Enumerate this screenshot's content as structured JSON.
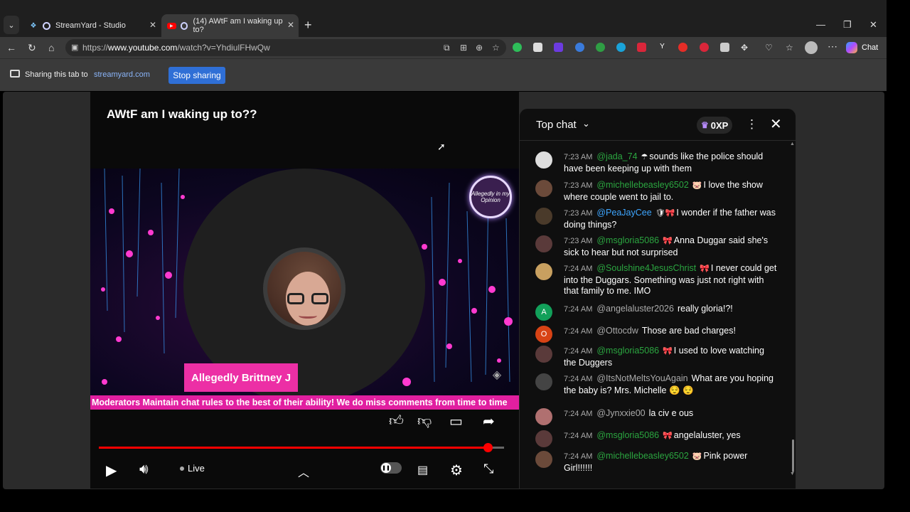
{
  "browser": {
    "tabs": [
      {
        "title": "StreamYard - Studio",
        "active": false
      },
      {
        "title": "(14) AWtF am I waking up to?",
        "active": true
      }
    ],
    "url_prefix": "https://",
    "url_host": "www.youtube.com",
    "url_path": "/watch?v=YhdiulFHwQw",
    "copilot_label": "Chat"
  },
  "sharebar": {
    "text": "Sharing this tab to",
    "link": "streamyard.com",
    "stop_label": "Stop sharing"
  },
  "video": {
    "title": "AWtF am I waking up to??",
    "logo_text": "Allegedly in my Opinion",
    "name_tag": "Allegedly Brittney J",
    "ticker": "Moderators Maintain chat rules to the best of their ability! We do miss comments from time to time",
    "live_label": "Live",
    "progress": 0.96
  },
  "chat": {
    "title": "Top chat",
    "xp": "0XP",
    "messages": [
      {
        "time": "7:23 AM",
        "user": "@jada_74",
        "user_color": "green",
        "badge": "☂",
        "text": "sounds like the police should have been keeping up with them",
        "avatar_color": "#dedede",
        "avatar_letter": ""
      },
      {
        "time": "7:23 AM",
        "user": "@michellebeasley6502",
        "user_color": "green",
        "badge": "🐷",
        "text": "I love the show where couple went to jail to.",
        "avatar_color": "#6b4a3a",
        "avatar_letter": ""
      },
      {
        "time": "7:23 AM",
        "user": "@PeaJayCee",
        "user_color": "blue",
        "badge": "🛡🎀",
        "text": "I wonder if the father was doing things?",
        "avatar_color": "#4a3a2a",
        "avatar_letter": ""
      },
      {
        "time": "7:23 AM",
        "user": "@msgloria5086",
        "user_color": "green",
        "badge": "🎀",
        "text": "Anna Duggar said she's sick to hear but not surprised",
        "avatar_color": "#5a3a3a",
        "avatar_letter": ""
      },
      {
        "time": "7:24 AM",
        "user": "@Soulshine4JesusChrist",
        "user_color": "green",
        "badge": "🎀",
        "text": "I never could get into the Duggars. Something was just not right with that family to me. IMO",
        "avatar_color": "#c8a060",
        "avatar_letter": ""
      },
      {
        "time": "7:24 AM",
        "user": "@angelaluster2026",
        "user_color": "gray",
        "badge": "",
        "text": "really gloria!?!",
        "avatar_color": "#12a05a",
        "avatar_letter": "A"
      },
      {
        "time": "7:24 AM",
        "user": "@Ottocdw",
        "user_color": "gray",
        "badge": "",
        "text": "Those are bad charges!",
        "avatar_color": "#d84315",
        "avatar_letter": "O"
      },
      {
        "time": "7:24 AM",
        "user": "@msgloria5086",
        "user_color": "green",
        "badge": "🎀",
        "text": "I used to love watching the Duggers",
        "avatar_color": "#5a3a3a",
        "avatar_letter": ""
      },
      {
        "time": "7:24 AM",
        "user": "@ItsNotMeltsYouAgain",
        "user_color": "gray",
        "badge": "",
        "text": "What are you hoping the baby is? Mrs. Michelle 😌 😌",
        "avatar_color": "#444",
        "avatar_letter": ""
      },
      {
        "time": "7:24 AM",
        "user": "@Jynxxie00",
        "user_color": "gray",
        "badge": "",
        "text": "la civ e ous",
        "avatar_color": "#b07070",
        "avatar_letter": ""
      },
      {
        "time": "7:24 AM",
        "user": "@msgloria5086",
        "user_color": "green",
        "badge": "🎀",
        "text": "angelaluster, yes",
        "avatar_color": "#5a3a3a",
        "avatar_letter": ""
      },
      {
        "time": "7:24 AM",
        "user": "@michellebeasley6502",
        "user_color": "green",
        "badge": "🐷",
        "text": "Pink power Girl!!!!!!",
        "avatar_color": "#6b4a3a",
        "avatar_letter": ""
      }
    ]
  }
}
